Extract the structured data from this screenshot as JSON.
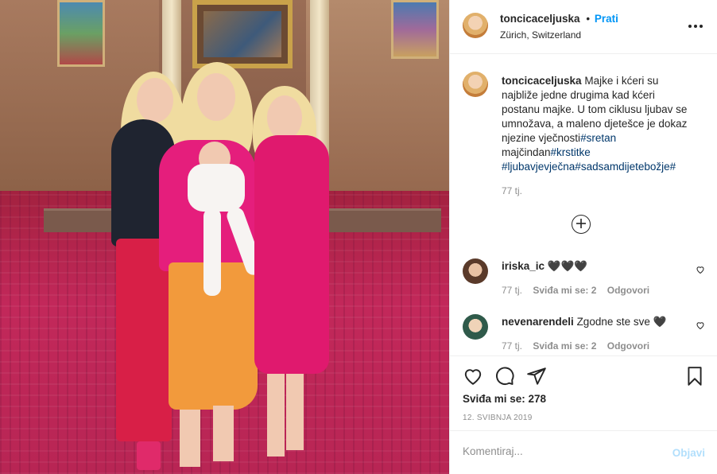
{
  "post": {
    "username": "toncicaceljuska",
    "follow_label": "Prati",
    "follow_separator": "•",
    "location": "Zürich, Switzerland",
    "more_icon": "more-horizontal-icon"
  },
  "caption": {
    "username": "toncicaceljuska",
    "text_plain_1": "Majke i kćeri su najbliže jedne drugima kad kćeri postanu majke. U tom ciklusu ljubav se umnožava, a maleno djetešce je dokaz njezine vječnosti",
    "hashtag_1": "#sretan",
    "text_plain_2": "majčindan",
    "hashtag_2": "#krstitke",
    "hashtag_3": "#ljubavjevječna#sadsamdijetebožje#",
    "time": "77 tj."
  },
  "load_more_icon": "plus-circle-icon",
  "comments": [
    {
      "username": "iriska_ic",
      "text": "🖤🖤🖤",
      "time": "77 tj.",
      "likes": "Sviđa mi se: 2",
      "reply": "Odgovori"
    },
    {
      "username": "nevenarendeli",
      "text": "Zgodne ste sve 🖤",
      "time": "77 tj.",
      "likes": "Sviđa mi se: 2",
      "reply": "Odgovori"
    }
  ],
  "actions": {
    "like_icon": "heart-icon",
    "comment_icon": "comment-icon",
    "share_icon": "send-icon",
    "save_icon": "bookmark-icon",
    "likes_text": "Sviđa mi se: 278",
    "date": "12. SVIBNJA 2019"
  },
  "comment_box": {
    "placeholder": "Komentiraj...",
    "post_label": "Objavi"
  },
  "colors": {
    "accent": "#0095f6",
    "hashtag": "#00376b",
    "muted": "#8e8e8e",
    "post_disabled": "#b2dffc"
  }
}
